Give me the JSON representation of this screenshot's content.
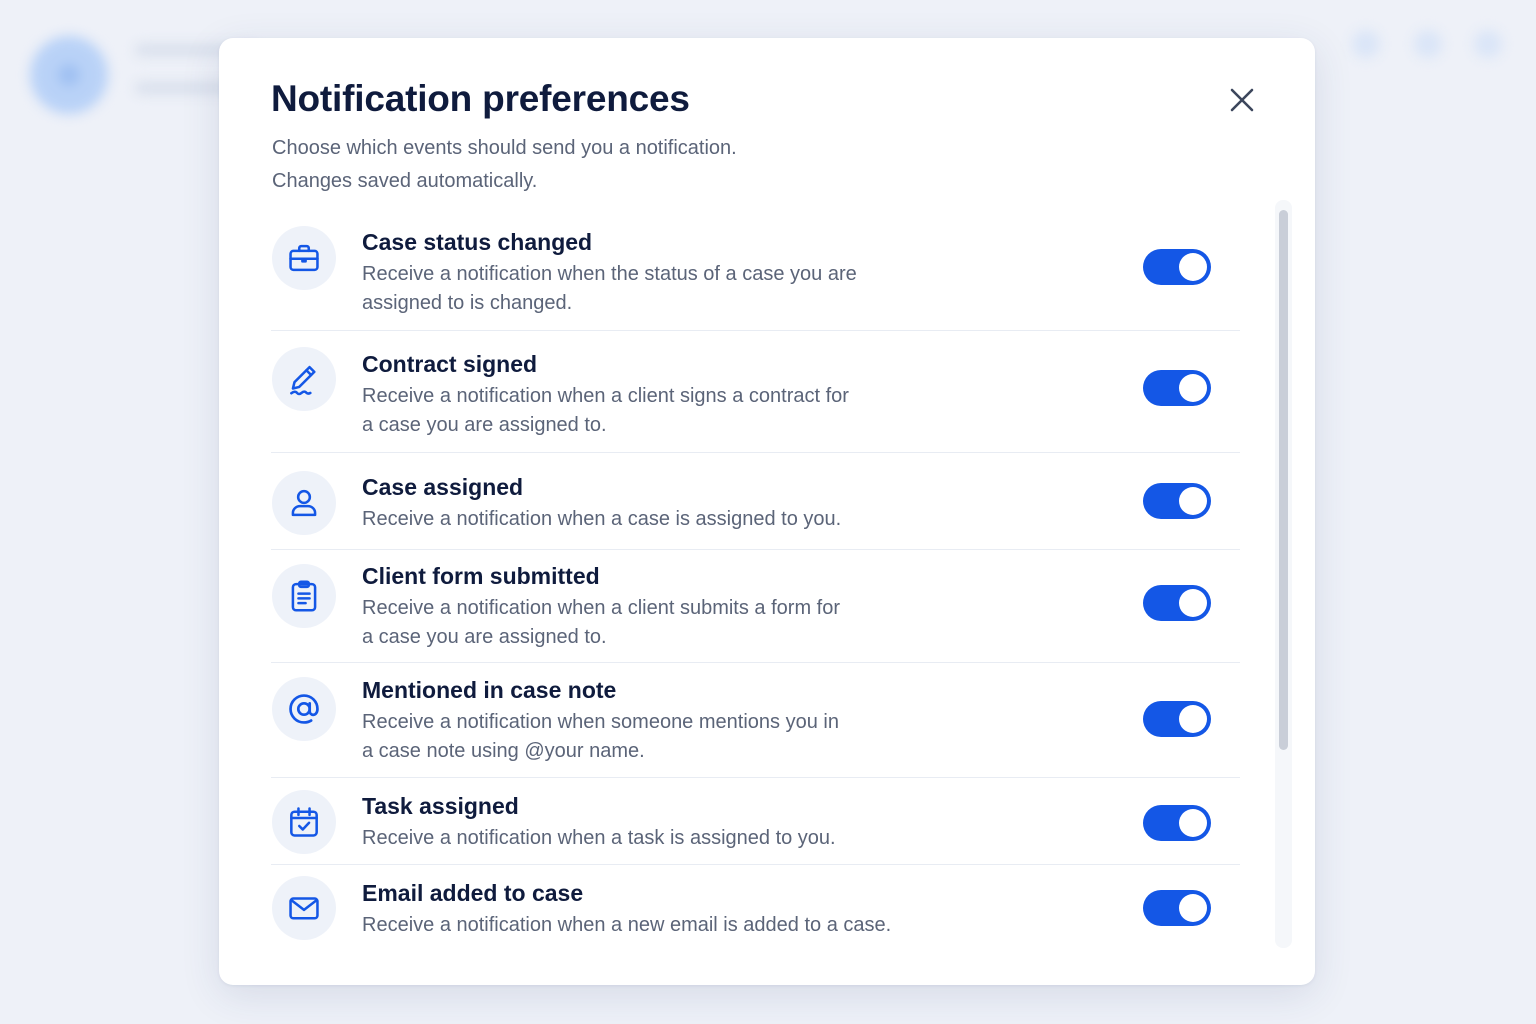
{
  "modal": {
    "title": "Notification preferences",
    "subtitle_line1": "Choose which events should send you a notification.",
    "subtitle_line2": "Changes saved automatically.",
    "close_icon": "close-icon"
  },
  "colors": {
    "accent": "#1457e6",
    "title": "#0f1b3d",
    "muted": "#5b6478",
    "icon_bg": "#eef2f9"
  },
  "notifications": [
    {
      "icon": "briefcase-icon",
      "title": "Case status changed",
      "desc_line1": "Receive a notification when the status of a case you are",
      "desc_line2": "assigned to is changed.",
      "enabled": true
    },
    {
      "icon": "signature-pen-icon",
      "title": "Contract signed",
      "desc_line1": "Receive a notification when a client signs a contract for",
      "desc_line2": "a case you are assigned to.",
      "enabled": true
    },
    {
      "icon": "user-icon",
      "title": "Case assigned",
      "desc_line1": "Receive a notification when a case is assigned to you.",
      "desc_line2": "",
      "enabled": true
    },
    {
      "icon": "clipboard-icon",
      "title": "Client form submitted",
      "desc_line1": "Receive a notification when a client submits a form for",
      "desc_line2": "a case you are assigned to.",
      "enabled": true
    },
    {
      "icon": "at-sign-icon",
      "title": "Mentioned in case note",
      "desc_line1": "Receive a notification when someone mentions you in",
      "desc_line2": "a case note using @your name.",
      "enabled": true
    },
    {
      "icon": "calendar-check-icon",
      "title": "Task assigned",
      "desc_line1": "Receive a notification when a task is assigned to you.",
      "desc_line2": "",
      "enabled": true
    },
    {
      "icon": "mail-icon",
      "title": "Email added to case",
      "desc_line1": "Receive a notification when a new email is added to a case.",
      "desc_line2": "",
      "enabled": true
    }
  ]
}
